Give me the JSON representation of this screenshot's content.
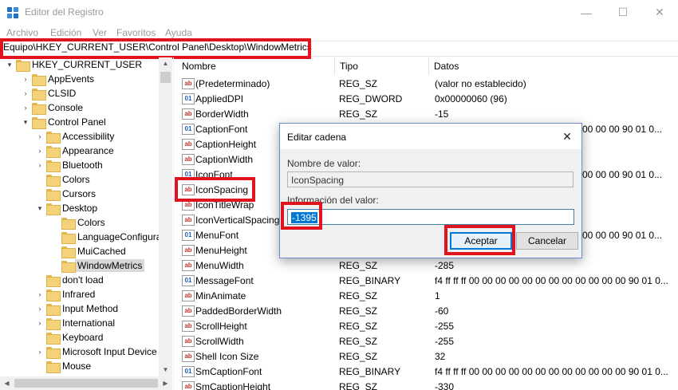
{
  "window": {
    "title": "Editor del Registro",
    "minimize_glyph": "—",
    "maximize_glyph": "☐",
    "close_glyph": "✕"
  },
  "menu": [
    "Archivo",
    "Edición",
    "Ver",
    "Favoritos",
    "Ayuda"
  ],
  "address": "Equipo\\HKEY_CURRENT_USER\\Control Panel\\Desktop\\WindowMetrics",
  "tree": [
    {
      "label": "HKEY_CURRENT_USER",
      "expander": "▾",
      "level": 0
    },
    {
      "label": "AppEvents",
      "expander": "›",
      "level": 1
    },
    {
      "label": "CLSID",
      "expander": "›",
      "level": 1
    },
    {
      "label": "Console",
      "expander": "›",
      "level": 1
    },
    {
      "label": "Control Panel",
      "expander": "▾",
      "level": 1
    },
    {
      "label": "Accessibility",
      "expander": "›",
      "level": 2
    },
    {
      "label": "Appearance",
      "expander": "›",
      "level": 2
    },
    {
      "label": "Bluetooth",
      "expander": "›",
      "level": 2
    },
    {
      "label": "Colors",
      "expander": "",
      "level": 2
    },
    {
      "label": "Cursors",
      "expander": "",
      "level": 2
    },
    {
      "label": "Desktop",
      "expander": "▾",
      "level": 2
    },
    {
      "label": "Colors",
      "expander": "",
      "level": 3
    },
    {
      "label": "LanguageConfigura",
      "expander": "",
      "level": 3
    },
    {
      "label": "MuiCached",
      "expander": "",
      "level": 3
    },
    {
      "label": "WindowMetrics",
      "expander": "",
      "level": 3,
      "selected": true
    },
    {
      "label": "don't load",
      "expander": "",
      "level": 2
    },
    {
      "label": "Infrared",
      "expander": "›",
      "level": 2
    },
    {
      "label": "Input Method",
      "expander": "›",
      "level": 2
    },
    {
      "label": "International",
      "expander": "›",
      "level": 2
    },
    {
      "label": "Keyboard",
      "expander": "",
      "level": 2
    },
    {
      "label": "Microsoft Input Device",
      "expander": "›",
      "level": 2
    },
    {
      "label": "Mouse",
      "expander": "",
      "level": 2
    }
  ],
  "columns": {
    "name": "Nombre",
    "type": "Tipo",
    "data": "Datos"
  },
  "values": [
    {
      "name": "(Predeterminado)",
      "type": "REG_SZ",
      "data": "(valor no establecido)",
      "kind": "sz"
    },
    {
      "name": "AppliedDPI",
      "type": "REG_DWORD",
      "data": "0x00000060 (96)",
      "kind": "bin"
    },
    {
      "name": "BorderWidth",
      "type": "REG_SZ",
      "data": "-15",
      "kind": "sz"
    },
    {
      "name": "CaptionFont",
      "type": "",
      "data": "00 00 00 90 01 0...",
      "kind": "bin"
    },
    {
      "name": "CaptionHeight",
      "type": "",
      "data": "",
      "kind": "sz"
    },
    {
      "name": "CaptionWidth",
      "type": "",
      "data": "",
      "kind": "sz"
    },
    {
      "name": "IconFont",
      "type": "",
      "data": "00 00 00 90 01 0...",
      "kind": "bin"
    },
    {
      "name": "IconSpacing",
      "type": "",
      "data": "",
      "kind": "sz"
    },
    {
      "name": "IconTitleWrap",
      "type": "",
      "data": "",
      "kind": "sz"
    },
    {
      "name": "IconVerticalSpacing",
      "type": "",
      "data": "",
      "kind": "sz"
    },
    {
      "name": "MenuFont",
      "type": "",
      "data": "00 00 00 90 01 0...",
      "kind": "bin"
    },
    {
      "name": "MenuHeight",
      "type": "",
      "data": "",
      "kind": "sz"
    },
    {
      "name": "MenuWidth",
      "type": "REG_SZ",
      "data": "-285",
      "kind": "sz"
    },
    {
      "name": "MessageFont",
      "type": "REG_BINARY",
      "data": "f4 ff ff ff 00 00 00 00 00 00 00 00 00 00 00 00 90 01 0...",
      "kind": "bin"
    },
    {
      "name": "MinAnimate",
      "type": "REG_SZ",
      "data": "1",
      "kind": "sz"
    },
    {
      "name": "PaddedBorderWidth",
      "type": "REG_SZ",
      "data": "-60",
      "kind": "sz"
    },
    {
      "name": "ScrollHeight",
      "type": "REG_SZ",
      "data": "-255",
      "kind": "sz"
    },
    {
      "name": "ScrollWidth",
      "type": "REG_SZ",
      "data": "-255",
      "kind": "sz"
    },
    {
      "name": "Shell Icon Size",
      "type": "REG_SZ",
      "data": "32",
      "kind": "sz"
    },
    {
      "name": "SmCaptionFont",
      "type": "REG_BINARY",
      "data": "f4 ff ff ff 00 00 00 00 00 00 00 00 00 00 00 00 90 01 0...",
      "kind": "bin"
    },
    {
      "name": "SmCaptionHeight",
      "type": "REG_SZ",
      "data": "-330",
      "kind": "sz"
    }
  ],
  "dialog": {
    "title": "Editar cadena",
    "close_glyph": "✕",
    "name_label": "Nombre de valor:",
    "name_value": "IconSpacing",
    "data_label": "Información del valor:",
    "data_value": "-1395",
    "ok_label": "Aceptar",
    "cancel_label": "Cancelar"
  },
  "colors": {
    "highlight_border": "#e0141e",
    "selection": "#0078d7"
  }
}
